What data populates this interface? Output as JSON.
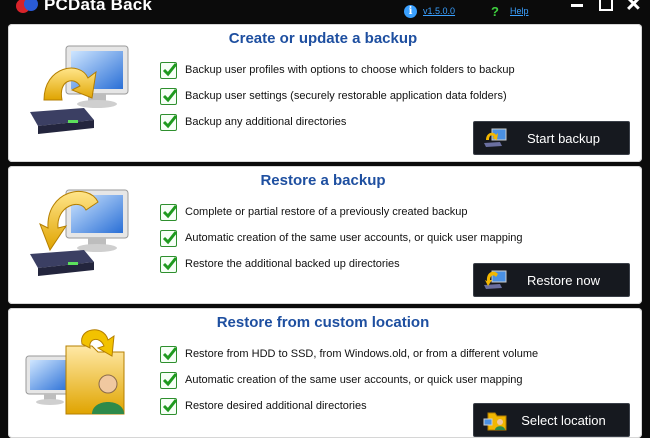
{
  "window": {
    "title": "PCData Back",
    "version": "v1.5.0.0",
    "help": "Help"
  },
  "sections": [
    {
      "title": "Create or update a backup",
      "features": [
        "Backup user profiles with options to choose which folders to backup",
        "Backup user settings (securely restorable application data folders)",
        "Backup any additional directories"
      ],
      "button": "Start backup"
    },
    {
      "title": "Restore a backup",
      "features": [
        "Complete or partial restore of a previously created backup",
        "Automatic creation of the same user accounts, or quick user mapping",
        "Restore the additional backed up directories"
      ],
      "button": "Restore now"
    },
    {
      "title": "Restore from custom location",
      "features": [
        "Restore from HDD to SSD, from Windows.old, or from a different volume",
        "Automatic creation of the same user accounts, or quick user mapping",
        "Restore desired additional directories"
      ],
      "button": "Select location"
    }
  ],
  "colors": {
    "background": "#0b0b0b",
    "section_title": "#1e4fa0",
    "link": "#3aa0ff",
    "check": "#2e8f2e",
    "button": "#16191f"
  },
  "icons": {
    "checkbox": "checkbox-checked-icon",
    "backup_illustration": "computer-backup-illustration",
    "restore_illustration": "computer-restore-illustration",
    "custom_illustration": "folder-user-illustration"
  }
}
